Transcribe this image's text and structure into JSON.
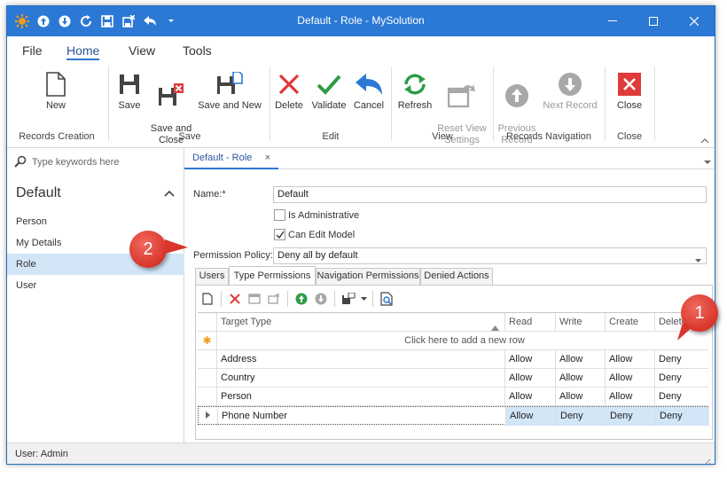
{
  "window": {
    "title": "Default - Role - MySolution",
    "accent": "#2b79d4"
  },
  "menu": {
    "tabs": [
      "File",
      "Home",
      "View",
      "Tools"
    ],
    "active": "Home"
  },
  "ribbon": {
    "buttons": {
      "new": "New",
      "save": "Save",
      "save_close": "Save and\nClose",
      "save_new": "Save and New",
      "delete": "Delete",
      "validate": "Validate",
      "cancel": "Cancel",
      "refresh": "Refresh",
      "reset_view": "Reset View\nSettings",
      "previous": "Previous\nRecord",
      "next": "Next Record",
      "close": "Close"
    },
    "groups": {
      "records_creation": "Records Creation",
      "save": "Save",
      "edit": "Edit",
      "view": "View",
      "records_navigation": "Records Navigation",
      "close": "Close"
    }
  },
  "nav": {
    "search_placeholder": "Type keywords here",
    "group": "Default",
    "items": [
      "Person",
      "My Details",
      "Role",
      "User"
    ],
    "selected": "Role"
  },
  "doc": {
    "tab": "Default - Role",
    "name_label": "Name:*",
    "name_value": "Default",
    "is_admin_label": "Is Administrative",
    "is_admin_checked": false,
    "can_edit_label": "Can Edit Model",
    "can_edit_checked": true,
    "policy_label": "Permission Policy:",
    "policy_value": "Deny all by default",
    "subtabs": [
      "Users",
      "Type Permissions",
      "Navigation Permissions",
      "Denied Actions"
    ],
    "active_subtab": "Type Permissions"
  },
  "grid": {
    "columns": [
      "Target Type",
      "Read",
      "Write",
      "Create",
      "Delete"
    ],
    "new_row_text": "Click here to add a new row",
    "rows": [
      [
        "Address",
        "Allow",
        "Allow",
        "Allow",
        "Deny"
      ],
      [
        "Country",
        "Allow",
        "Allow",
        "Allow",
        "Deny"
      ],
      [
        "Person",
        "Allow",
        "Allow",
        "Allow",
        "Deny"
      ],
      [
        "Phone Number",
        "Allow",
        "Deny",
        "Deny",
        "Deny"
      ]
    ]
  },
  "status": {
    "text": "User: Admin"
  },
  "callouts": [
    "1",
    "2"
  ]
}
